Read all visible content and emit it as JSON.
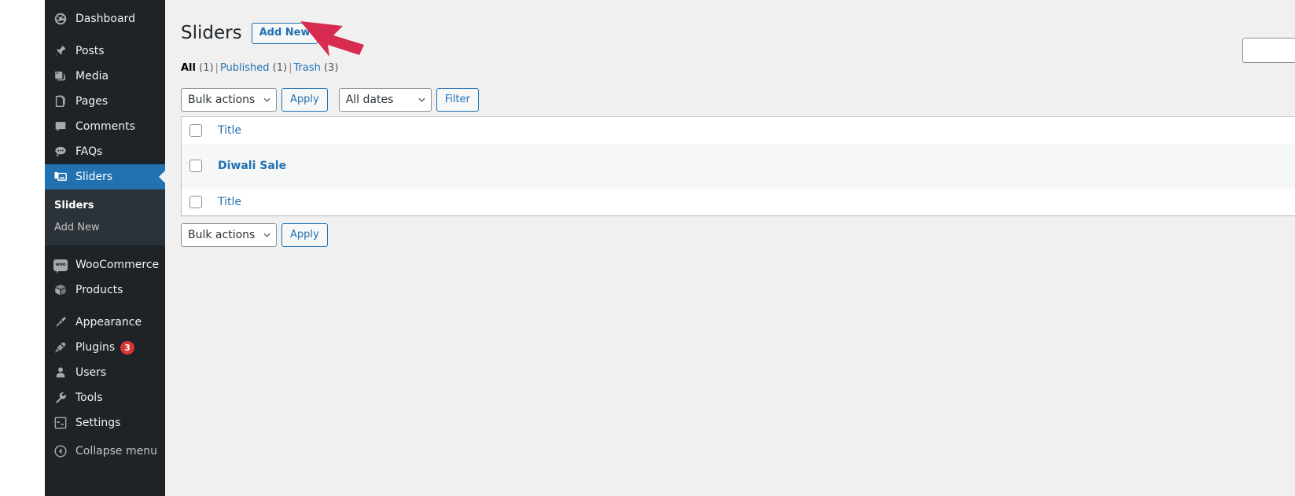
{
  "sidebar": {
    "items": [
      {
        "label": "Dashboard",
        "icon": "dashboard-icon",
        "current": false
      },
      {
        "label": "Posts",
        "icon": "pin-icon",
        "current": false
      },
      {
        "label": "Media",
        "icon": "media-icon",
        "current": false
      },
      {
        "label": "Pages",
        "icon": "pages-icon",
        "current": false
      },
      {
        "label": "Comments",
        "icon": "comments-icon",
        "current": false
      },
      {
        "label": "FAQs",
        "icon": "chat-icon",
        "current": false
      },
      {
        "label": "Sliders",
        "icon": "sliders-icon",
        "current": true
      },
      {
        "label": "WooCommerce",
        "icon": "woocommerce-icon",
        "current": false
      },
      {
        "label": "Products",
        "icon": "products-box-icon",
        "current": false
      },
      {
        "label": "Appearance",
        "icon": "paintbrush-icon",
        "current": false
      },
      {
        "label": "Plugins",
        "icon": "plug-icon",
        "current": false,
        "badge": "3"
      },
      {
        "label": "Users",
        "icon": "user-icon",
        "current": false
      },
      {
        "label": "Tools",
        "icon": "wrench-icon",
        "current": false
      },
      {
        "label": "Settings",
        "icon": "sliders-settings-icon",
        "current": false
      },
      {
        "label": "Collapse menu",
        "icon": "collapse-arrow-icon",
        "current": false
      }
    ],
    "submenu": [
      {
        "label": "Sliders",
        "current": true
      },
      {
        "label": "Add New",
        "current": false
      }
    ],
    "badge_color": "#d63638",
    "active_color": "#2271b1"
  },
  "page": {
    "title": "Sliders",
    "add_new_label": "Add New"
  },
  "views": {
    "all": {
      "label": "All",
      "count": "(1)"
    },
    "published": {
      "label": "Published",
      "count": "(1)"
    },
    "trash": {
      "label": "Trash",
      "count": "(3)"
    },
    "separator": "|"
  },
  "search": {
    "value": "",
    "placeholder": ""
  },
  "tablenav_top": {
    "bulk_actions_label": "Bulk actions",
    "apply_label": "Apply",
    "dates_label": "All dates",
    "filter_label": "Filter"
  },
  "tablenav_bottom": {
    "bulk_actions_label": "Bulk actions",
    "apply_label": "Apply"
  },
  "table": {
    "columns": [
      "Title"
    ],
    "header_title": "Title",
    "footer_title": "Title",
    "rows": [
      {
        "title": "Diwali Sale"
      }
    ]
  },
  "annotation": {
    "arrow_color": "#d82b50"
  }
}
